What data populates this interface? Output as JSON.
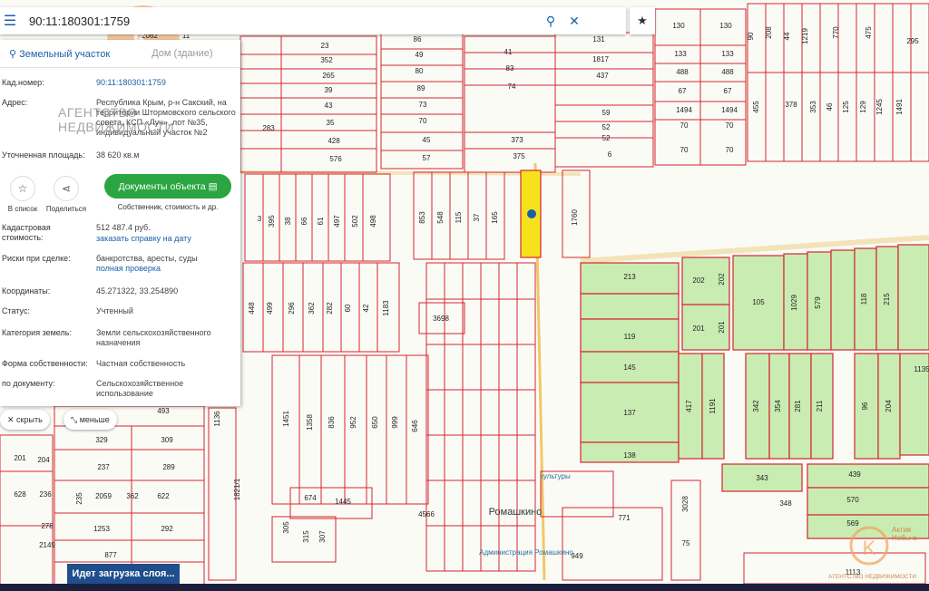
{
  "search": {
    "value": "90:11:180301:1759"
  },
  "panel": {
    "tab_parcel": "Земельный участок",
    "tab_building": "Дом (здание)",
    "rows": {
      "cad_number": {
        "label": "Кад.номер:",
        "value": "90:11:180301:1759"
      },
      "address": {
        "label": "Адрес:",
        "value": "Республика Крым, р-н Сакский, на территории Штормовского сельского совета, КСП «Луч», лот №35, индивидуальный участок №2"
      },
      "area": {
        "label": "Уточненная площадь:",
        "value": "38 620 кв.м"
      },
      "cad_cost": {
        "label": "Кадастровая стоимость:",
        "value": "512 487.4 руб.",
        "link": "заказать справку на дату"
      },
      "risks": {
        "label": "Риски при сделке:",
        "value": "банкротства, аресты, суды",
        "link": "полная проверка"
      },
      "coords": {
        "label": "Координаты:",
        "value": "45.271322, 33.254890"
      },
      "status": {
        "label": "Статус:",
        "value": "Учтенный"
      },
      "category": {
        "label": "Категория земель:",
        "value": "Земли сельскохозяйственного назначения"
      },
      "ownership": {
        "label": "Форма собственности:",
        "value": "Частная собственность"
      },
      "by_document": {
        "label": "по документу:",
        "value": "Сельскохозяйственное использование"
      }
    },
    "actions": {
      "to_list": "В список",
      "share": "Поделиться",
      "documents_button": "Документы объекта",
      "documents_sub": "Собственник, стоимость и др."
    },
    "watermark": "АГЕНТСТВО НЕДВИЖИМОСТИ"
  },
  "buttons": {
    "hide": "скрыть",
    "less": "меньше"
  },
  "status": {
    "loading": "Идет загрузка слоя..."
  },
  "overlay": {
    "agency": "АГЕНТСТВО НЕДВИЖИМОСТИ",
    "agency_top": "Актив",
    "agency_mid": "Нобы а"
  },
  "map": {
    "settlement": "Ромашкино",
    "place_labels": [
      "культуры",
      "Администрация Ромашкино"
    ],
    "colors": {
      "parcel_line": "#d6262f",
      "agri_fill": "#c9ecb3",
      "selected_fill": "#f5e21c",
      "road": "#f3e3b8",
      "marker": "#1a5fa8"
    },
    "labels": {
      "top_left_block": [
        "2062",
        "11",
        "23",
        "352",
        "265",
        "39",
        "43",
        "35",
        "428",
        "576",
        "283"
      ],
      "top_mid": [
        "86",
        "49",
        "80",
        "89",
        "73",
        "70",
        "45",
        "57",
        "41",
        "83",
        "74",
        "373",
        "375"
      ],
      "top_right": [
        "131",
        "1817",
        "437",
        "59",
        "52",
        "52",
        "6",
        "130",
        "133",
        "488",
        "67",
        "1494",
        "70",
        "70",
        "130",
        "133",
        "488",
        "67",
        "1494",
        "70",
        "70"
      ],
      "far_right_top": [
        "90",
        "208",
        "44",
        "1219",
        "770",
        "475",
        "295",
        "455",
        "378",
        "353",
        "46",
        "125",
        "129",
        "1245",
        "1491"
      ],
      "strip_row": [
        "395",
        "38",
        "66",
        "61",
        "497",
        "502",
        "498",
        "3",
        "853",
        "548",
        "115",
        "37",
        "165",
        "1760"
      ],
      "second_row": [
        "448",
        "499",
        "296",
        "362",
        "282",
        "60",
        "42",
        "1183",
        "3698"
      ],
      "lower_left": [
        "1451",
        "1358",
        "836",
        "952",
        "650",
        "999",
        "646",
        "1136"
      ],
      "green_block": [
        "213",
        "202",
        "202",
        "201",
        "201",
        "119",
        "145",
        "137",
        "138",
        "105",
        "1029",
        "579",
        "118",
        "215",
        "417",
        "1191",
        "342",
        "354",
        "281",
        "211",
        "96",
        "204",
        "1135"
      ],
      "bottom_left": [
        "493",
        "329",
        "309",
        "237",
        "289",
        "201",
        "204",
        "628",
        "236",
        "235",
        "2059",
        "362",
        "622",
        "278",
        "1253",
        "292",
        "2149",
        "877"
      ],
      "bottom_center": [
        "674",
        "1445",
        "305",
        "315",
        "307",
        "4566",
        "1821/1",
        "771"
      ],
      "bottom_right": [
        "343",
        "439",
        "348",
        "570",
        "569",
        "3028",
        "75",
        "949",
        "1113"
      ]
    }
  }
}
